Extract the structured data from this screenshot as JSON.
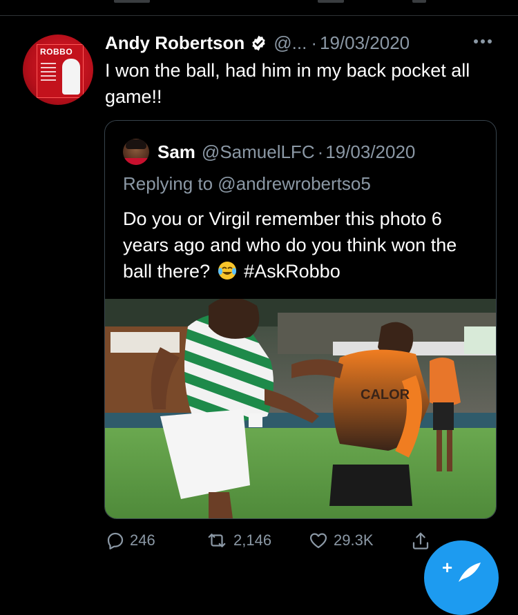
{
  "tweet": {
    "author_name": "Andy Robertson",
    "handle": "@...",
    "separator": "·",
    "date": "19/03/2020",
    "text": "I won the ball, had him in my back pocket all game!!",
    "avatar_book_title": "ROBBO"
  },
  "quoted_tweet": {
    "author_name": "Sam",
    "handle": "@SamuelLFC",
    "separator": "·",
    "date": "19/03/2020",
    "replying_to": "Replying to @andrewrobertso5",
    "text_part1": "Do you or Virgil remember this photo 6 years ago and who do you think won the ball there?",
    "text_part2": "#AskRobbo",
    "photo_sponsor_text": "CALOR"
  },
  "actions": {
    "replies": "246",
    "retweets": "2,146",
    "likes": "29.3K"
  },
  "icons": {
    "verified": "verified-badge-icon",
    "more": "more-horizontal-icon",
    "reply": "reply-icon",
    "retweet": "retweet-icon",
    "like": "heart-icon",
    "share": "share-icon",
    "compose": "compose-tweet-icon"
  },
  "colors": {
    "background": "#000000",
    "secondary_text": "#8b98a5",
    "border": "#38444d",
    "accent": "#1d9bf0"
  }
}
